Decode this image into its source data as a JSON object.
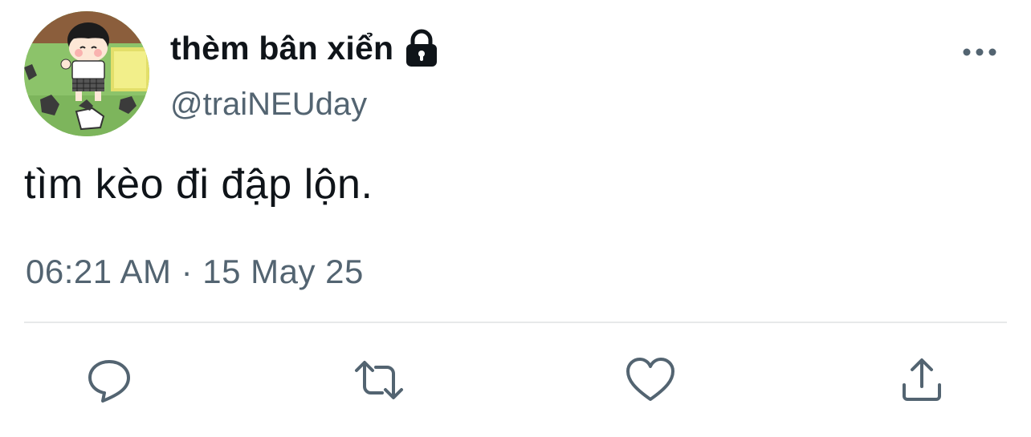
{
  "tweet": {
    "author": {
      "display_name": "thèm bân xiển",
      "handle": "@traiNEUday",
      "protected": true,
      "avatar_icon": "avatar-cartoon-boy"
    },
    "text": "tìm kèo đi đập lộn.",
    "timestamp": "06:21 AM · 15 May 25",
    "actions": [
      {
        "name": "reply",
        "icon": "speech-bubble-icon"
      },
      {
        "name": "retweet",
        "icon": "retweet-icon"
      },
      {
        "name": "like",
        "icon": "heart-icon"
      },
      {
        "name": "share",
        "icon": "share-upload-icon"
      }
    ],
    "more_icon": "ellipsis-icon"
  },
  "colors": {
    "text_primary": "#0f1419",
    "text_secondary": "#536471",
    "divider": "#e7e9ea",
    "icon": "#536471"
  }
}
